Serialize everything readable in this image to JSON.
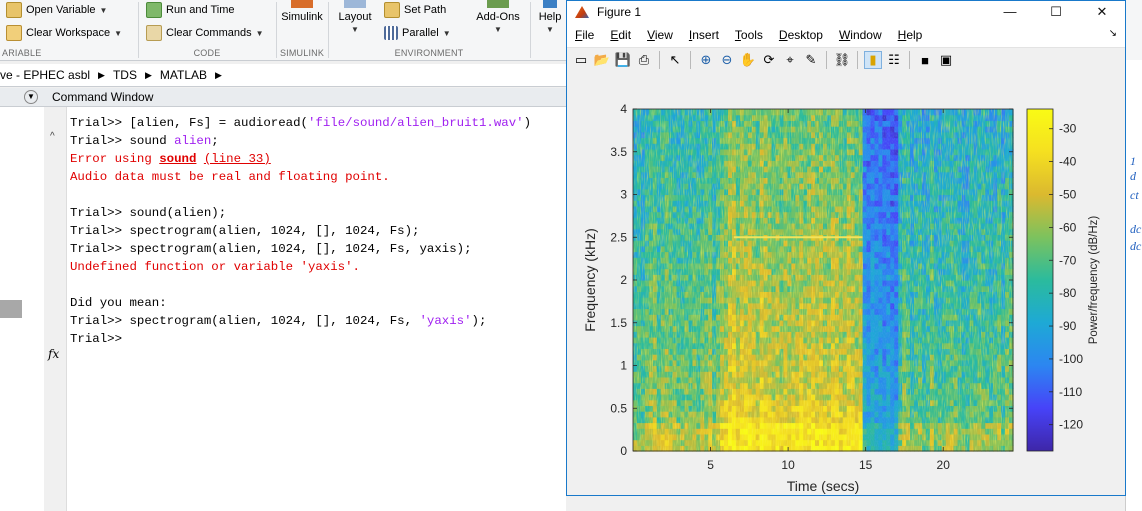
{
  "ribbon": {
    "open_variable": "Open Variable",
    "clear_workspace": "Clear Workspace",
    "run_and_time": "Run and Time",
    "clear_commands": "Clear Commands",
    "simulink": "Simulink",
    "layout": "Layout",
    "set_path": "Set Path",
    "parallel": "Parallel",
    "add_ons": "Add-Ons",
    "help": "Help",
    "sections": {
      "variable": "ARIABLE",
      "code": "CODE",
      "simulink": "SIMULINK",
      "environment": "ENVIRONMENT"
    }
  },
  "address": {
    "crumbs": [
      "ve - EPHEC asbl",
      "TDS",
      "MATLAB"
    ]
  },
  "command_window": {
    "title": "Command Window",
    "lines": [
      {
        "parts": [
          {
            "t": "Trial>> [alien, Fs] = audioread("
          },
          {
            "t": "'file/sound/alien_bruit1.wav'",
            "c": "str"
          },
          {
            "t": ")"
          }
        ]
      },
      {
        "parts": [
          {
            "t": "Trial>> sound "
          },
          {
            "t": "alien",
            "c": "str"
          },
          {
            "t": ";"
          }
        ]
      },
      {
        "parts": [
          {
            "t": "Error using ",
            "c": "err"
          },
          {
            "t": "sound",
            "c": "errlink-b"
          },
          {
            "t": " ",
            "c": "err"
          },
          {
            "t": "(line 33)",
            "c": "errlink"
          }
        ]
      },
      {
        "parts": [
          {
            "t": "Audio data must be real and floating point.",
            "c": "err"
          }
        ]
      },
      {
        "parts": [
          {
            "t": ""
          }
        ]
      },
      {
        "parts": [
          {
            "t": "Trial>> sound(alien);"
          }
        ]
      },
      {
        "parts": [
          {
            "t": "Trial>> spectrogram(alien, 1024, [], 1024, Fs);"
          }
        ]
      },
      {
        "parts": [
          {
            "t": "Trial>> spectrogram(alien, 1024, [], 1024, Fs, yaxis);"
          }
        ]
      },
      {
        "parts": [
          {
            "t": "Undefined function or variable 'yaxis'.",
            "c": "err"
          }
        ]
      },
      {
        "parts": [
          {
            "t": ""
          }
        ]
      },
      {
        "parts": [
          {
            "t": "Did you mean:"
          }
        ]
      },
      {
        "parts": [
          {
            "t": "Trial>> spectrogram(alien, 1024, [], 1024, Fs, "
          },
          {
            "t": "'yaxis'",
            "c": "str"
          },
          {
            "t": ");"
          }
        ]
      },
      {
        "parts": [
          {
            "t": "Trial>>"
          }
        ]
      }
    ],
    "fx_label": "fx"
  },
  "right_strip": {
    "fragments": [
      "1 d",
      "ct",
      "dc",
      "dc"
    ]
  },
  "figure": {
    "title": "Figure 1",
    "window_buttons": [
      "—",
      "☐",
      "✕"
    ],
    "menus": [
      "File",
      "Edit",
      "View",
      "Insert",
      "Tools",
      "Desktop",
      "Window",
      "Help"
    ],
    "menu_underline": [
      "F",
      "E",
      "V",
      "I",
      "T",
      "D",
      "W",
      "H"
    ],
    "toolbar_icons": [
      "new-figure-icon",
      "open-file-icon",
      "save-icon",
      "print-icon",
      "|",
      "pointer-icon",
      "|",
      "zoom-in-icon",
      "zoom-out-icon",
      "pan-icon",
      "rotate-icon",
      "data-cursor-icon",
      "brush-icon",
      "|",
      "link-icon",
      "|",
      "colorbar-icon",
      "legend-icon",
      "|",
      "hide-tools-icon",
      "dock-icon"
    ]
  },
  "chart_data": {
    "type": "heatmap",
    "xlabel": "Time (secs)",
    "ylabel": "Frequency (kHz)",
    "colorbar_label": "Power/frequency (dB/Hz)",
    "xlim": [
      0,
      24.5
    ],
    "ylim": [
      0,
      4
    ],
    "xticks": [
      5,
      10,
      15,
      20
    ],
    "yticks": [
      0,
      0.5,
      1,
      1.5,
      2,
      2.5,
      3,
      3.5,
      4
    ],
    "clim": [
      -128,
      -24
    ],
    "cticks": [
      -30,
      -40,
      -50,
      -60,
      -70,
      -80,
      -90,
      -100,
      -110,
      -120
    ],
    "colormap": [
      "#3e26a8",
      "#4743f8",
      "#2c86f1",
      "#1ea9d5",
      "#2bbb9d",
      "#7cc25e",
      "#dbb92f",
      "#f5e020",
      "#f9fb15"
    ],
    "segments": [
      {
        "t0": 0.0,
        "t1": 5.5,
        "level": 0.62,
        "desc": "moderate broadband"
      },
      {
        "t0": 5.5,
        "t1": 14.8,
        "level": 0.78,
        "desc": "loud broadband"
      },
      {
        "t0": 14.8,
        "t1": 17.2,
        "level": 0.35,
        "desc": "quiet"
      },
      {
        "t0": 17.2,
        "t1": 24.5,
        "level": 0.58,
        "desc": "moderate broadband"
      }
    ],
    "tone": {
      "t0": 6.5,
      "t1": 14.8,
      "freq_khz": 2.5
    }
  }
}
